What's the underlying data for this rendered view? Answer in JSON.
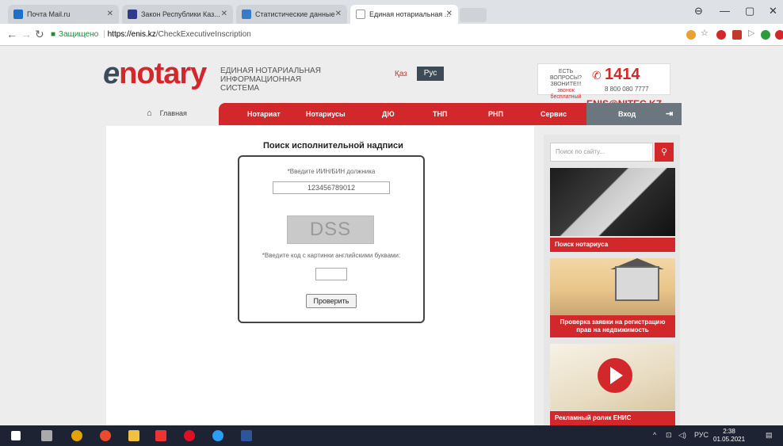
{
  "browser": {
    "tabs": [
      {
        "label": "Почта Mail.ru",
        "icon": "mail-icon",
        "color": "#1e6fc8",
        "active": false
      },
      {
        "label": "Закон Республики Каз...",
        "icon": "law-icon",
        "color": "#2f3b8c",
        "active": false
      },
      {
        "label": "Статистические данные",
        "icon": "stats-icon",
        "color": "#3b7ac7",
        "active": false
      },
      {
        "label": "Единая нотариальная ...",
        "icon": "page-icon",
        "color": "#bbbbbb",
        "active": true
      }
    ],
    "secure_label": "Защищено",
    "url_host": "https://enis.kz",
    "url_path": "/CheckExecutiveInscription"
  },
  "site": {
    "logo_e": "e",
    "logo_rest": "notary",
    "system_name": "ЕДИНАЯ НОТАРИАЛЬНАЯ ИНФОРМАЦИОННАЯ СИСТЕМА",
    "lang_kaz": "Қаз",
    "lang_rus": "Рус",
    "hotline_question": "ЕСТЬ ВОПРОСЫ? ЗВОНИТЕ!!!",
    "hotline_free": "звонок бесплатный",
    "hotline_number": "1414",
    "hotline_number2": "8 800 080 7777",
    "email": "ENIS@NITEC.KZ"
  },
  "nav": {
    "home": "Главная",
    "items": [
      "Нотариат",
      "Нотариусы",
      "ДЮ",
      "ТНП",
      "РНП",
      "Сервис"
    ],
    "login": "Вход"
  },
  "form": {
    "title": "Поиск исполнительной надписи",
    "iin_label": "*Введите ИИН/БИН должника",
    "iin_value": "123456789012",
    "captcha_text": "DSS",
    "code_label": "*Введите код с картинки английскими буквами:",
    "code_value": "",
    "submit": "Проверить"
  },
  "sidebar": {
    "search_placeholder": "Поиск по сайту...",
    "banners": [
      "Поиск нотариуса",
      "Проверка заявки на регистрацию прав на недвижимость",
      "Рекламный ролик ЕНИС"
    ]
  },
  "taskbar": {
    "lang": "РУС",
    "time": "2:38",
    "date": "01.05.2021"
  }
}
